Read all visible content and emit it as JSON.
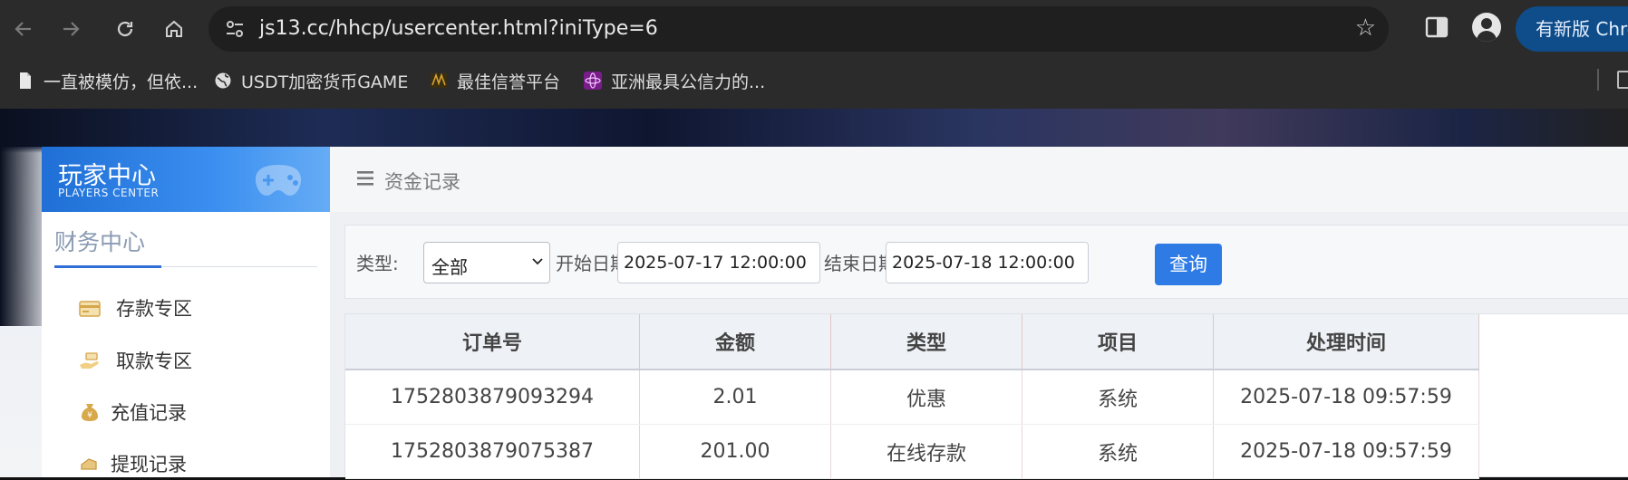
{
  "browser": {
    "url": "js13.cc/hhcp/usercenter.html?iniType=6",
    "update_label": "有新版 Chrome",
    "bookmarks": [
      {
        "label": "一直被模仿，但依...",
        "icon": "page-icon"
      },
      {
        "label": "USDT加密货币GAME",
        "icon": "globe-icon"
      },
      {
        "label": "最佳信誉平台",
        "icon": "site-logo-icon"
      },
      {
        "label": "亚洲最具公信力的...",
        "icon": "atom-logo-icon"
      }
    ]
  },
  "sidebar": {
    "title_cn": "玩家中心",
    "title_en": "PLAYERS CENTER",
    "section": "财务中心",
    "items": [
      {
        "label": "存款专区",
        "icon": "card-icon"
      },
      {
        "label": "取款专区",
        "icon": "hand-money-icon"
      },
      {
        "label": "充值记录",
        "icon": "money-bag-icon"
      },
      {
        "label": "提现记录",
        "icon": "withdraw-icon"
      }
    ]
  },
  "main": {
    "breadcrumb": "资金记录",
    "filter": {
      "type_label": "类型:",
      "type_value": "全部",
      "start_label": "开始日期:",
      "start_value": "2025-07-17 12:00:00",
      "end_label": "结束日期:",
      "end_value": "2025-07-18 12:00:00",
      "query_label": "查询"
    },
    "table": {
      "headers": [
        "订单号",
        "金额",
        "类型",
        "项目",
        "处理时间"
      ],
      "rows": [
        [
          "1752803879093294",
          "2.01",
          "优惠",
          "系统",
          "2025-07-18 09:57:59"
        ],
        [
          "1752803879075387",
          "201.00",
          "在线存款",
          "系统",
          "2025-07-18 09:57:59"
        ]
      ]
    }
  },
  "colors": {
    "accent": "#2e7be6",
    "browser_bg": "#2b2b2b",
    "sidebar_header": "#2f80e8"
  }
}
